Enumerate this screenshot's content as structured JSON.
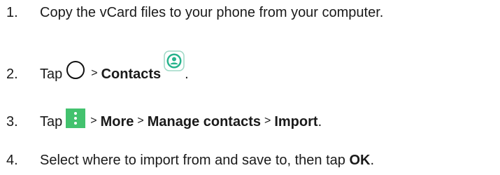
{
  "steps": [
    {
      "number": "1.",
      "text": "Copy the vCard files to your phone from your computer."
    },
    {
      "number": "2.",
      "tap": "Tap",
      "gt": ">",
      "contacts": "Contacts",
      "end": ".",
      "icons": [
        "home-circle-icon",
        "contacts-app-icon"
      ]
    },
    {
      "number": "3.",
      "tap": "Tap",
      "gt1": ">",
      "more": "More",
      "gt2": ">",
      "manage": "Manage contacts",
      "gt3": ">",
      "import": "Import",
      "end": ".",
      "icons": [
        "more-vert-menu-icon"
      ]
    },
    {
      "number": "4.",
      "text": "Select where to import from and save to, then tap",
      "ok": "OK",
      "end": "."
    }
  ],
  "colors": {
    "text": "#1a1a1a",
    "menu_icon_bg": "#43c26e",
    "contacts_icon_bg": "#27b38c",
    "contacts_icon_border": "#9fd9c6"
  }
}
